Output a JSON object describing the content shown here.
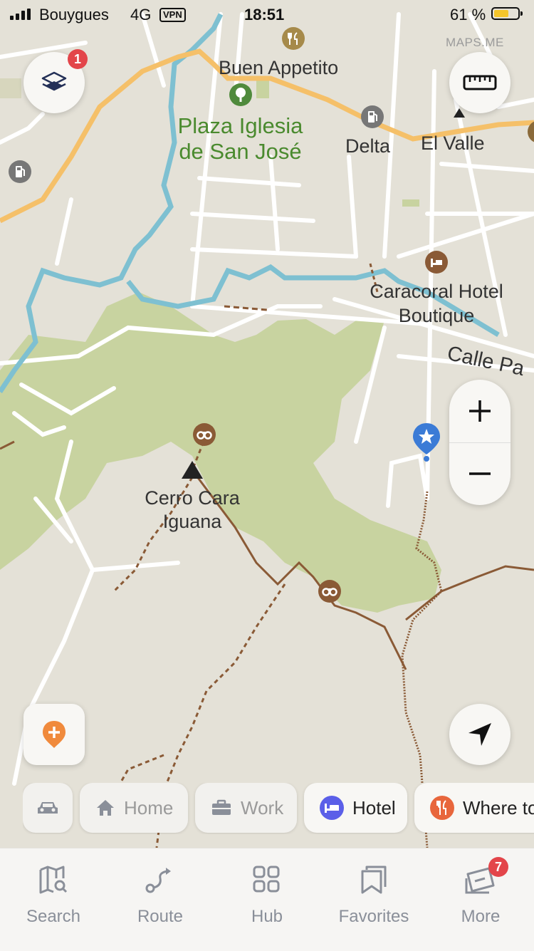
{
  "status_bar": {
    "carrier": "Bouygues",
    "network": "4G",
    "vpn": "VPN",
    "time": "18:51",
    "battery": "61 %",
    "battery_level": 0.61
  },
  "map": {
    "watermark": "MAPS.ME",
    "labels": {
      "buen_appetito": "Buen Appetito",
      "plaza_line1": "Plaza Iglesia",
      "plaza_line2": "de San José",
      "delta": "Delta",
      "el_valle": "El Valle",
      "caracoral_line1": "Caracoral Hotel",
      "caracoral_line2": "Boutique",
      "calle": "Calle Pa",
      "cerro_line1": "Cerro Cara",
      "cerro_line2": "Iguana"
    }
  },
  "controls": {
    "layers_badge": "1",
    "layers_icon": "layers-icon",
    "ruler_icon": "ruler-icon",
    "zoom_in": "+",
    "zoom_out": "−",
    "add_place_icon": "add-place-icon",
    "my_location_icon": "navigation-arrow-icon"
  },
  "chips": [
    {
      "label": "",
      "icon": "car-icon"
    },
    {
      "label": "Home",
      "icon": "home-icon"
    },
    {
      "label": "Work",
      "icon": "briefcase-icon"
    },
    {
      "label": "Hotel",
      "icon": "bed-icon",
      "color": "#5b5fe8"
    },
    {
      "label": "Where to eat",
      "icon": "cutlery-icon",
      "color": "#e8663c"
    }
  ],
  "tabs": [
    {
      "label": "Search",
      "icon": "map-search-icon"
    },
    {
      "label": "Route",
      "icon": "route-icon"
    },
    {
      "label": "Hub",
      "icon": "grid-icon"
    },
    {
      "label": "Favorites",
      "icon": "bookmarks-icon"
    },
    {
      "label": "More",
      "icon": "more-ticket-icon",
      "badge": "7"
    }
  ]
}
